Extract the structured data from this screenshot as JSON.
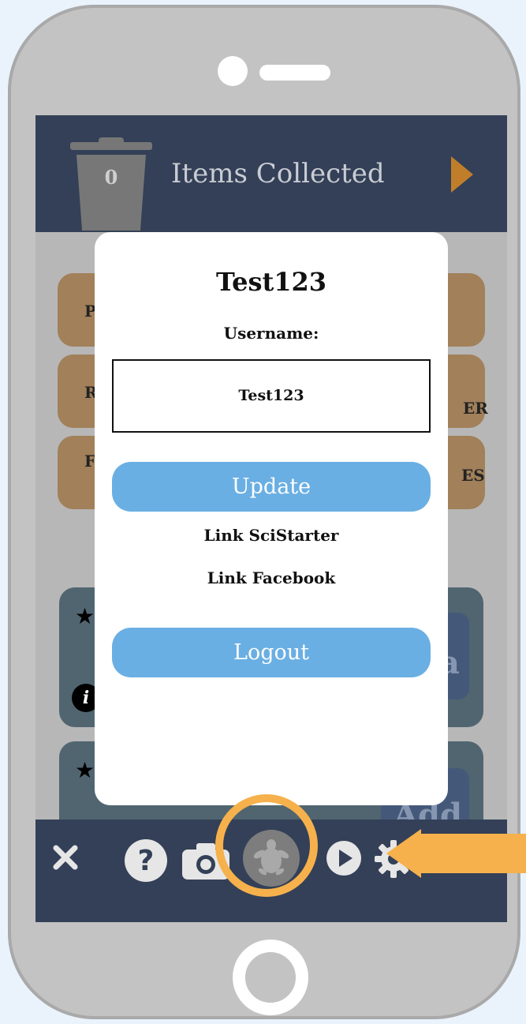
{
  "header": {
    "items_count": "0",
    "title": "Items Collected"
  },
  "background_menu": {
    "tiles": [
      {
        "left_text": "P",
        "right_text": ""
      },
      {
        "left_text": "R",
        "right_text": "ER"
      },
      {
        "left_text": "F",
        "right_text": "ES"
      }
    ],
    "cards": [
      {
        "star": "★",
        "info": "i",
        "add_text": "a"
      },
      {
        "star": "★",
        "add_text": "Add"
      }
    ]
  },
  "profile_modal": {
    "title": "Test123",
    "username_label": "Username:",
    "username_value": "Test123",
    "update_label": "Update",
    "link_scistarter_label": "Link SciStarter",
    "link_facebook_label": "Link Facebook",
    "logout_label": "Logout"
  },
  "bottom_bar": {
    "icons": [
      "close-icon",
      "help-icon",
      "camera-icon",
      "turtle-profile-icon",
      "play-icon",
      "gear-icon"
    ]
  },
  "colors": {
    "header_bg": "#334057",
    "accent_orange": "#f6b14c",
    "button_blue": "#6aafe3",
    "tile_tan": "#a1805a",
    "card_slate": "#506570"
  }
}
